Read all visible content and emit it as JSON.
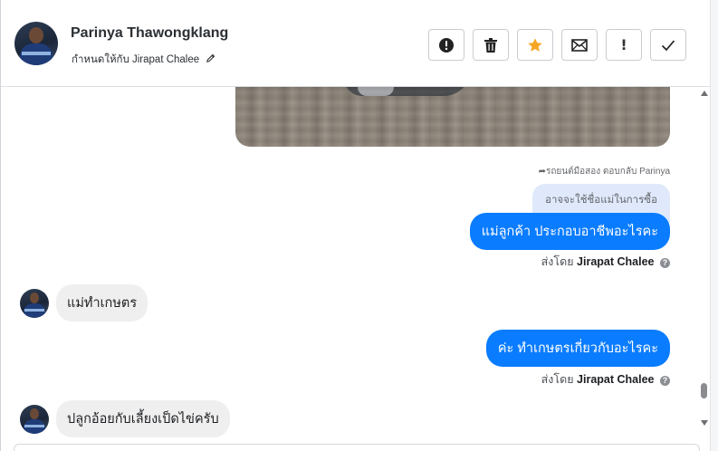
{
  "header": {
    "contact_name": "Parinya Thawongklang",
    "assigned_prefix": "กำหนดให้กับ",
    "assigned_to": "Jirapat Chalee",
    "actions": [
      {
        "name": "report",
        "icon": "exclamation-circle-icon"
      },
      {
        "name": "delete",
        "icon": "trash-icon"
      },
      {
        "name": "star",
        "icon": "star-icon",
        "color": "#f5a623"
      },
      {
        "name": "mark-unread",
        "icon": "envelope-icon"
      },
      {
        "name": "important",
        "icon": "exclamation-icon",
        "label": "!"
      },
      {
        "name": "done",
        "icon": "check-icon"
      }
    ]
  },
  "messages": {
    "reply_meta": "รถยนต์มือสอง ตอบกลับ Parinya",
    "quoted_text": "อาจจะใช้ชื่อแม่ในการซื้อ",
    "outgoing_1": "แม่ลูกค้า ประกอบอาชีพอะไรคะ",
    "sent_by_prefix": "ส่งโดย",
    "sent_by_name": "Jirapat Chalee",
    "incoming_1": "แม่ทำเกษตร",
    "outgoing_2": "ค่ะ ทำเกษตรเกี่ยวกับอะไรคะ",
    "incoming_2": "ปลูกอ้อยกับเลี้ยงเป็ดไข่ครับ"
  },
  "colors": {
    "outgoing_bubble": "#0a7cff",
    "incoming_bubble": "#efefef",
    "quoted_bubble": "#dfe9fb",
    "star": "#f5a623"
  }
}
